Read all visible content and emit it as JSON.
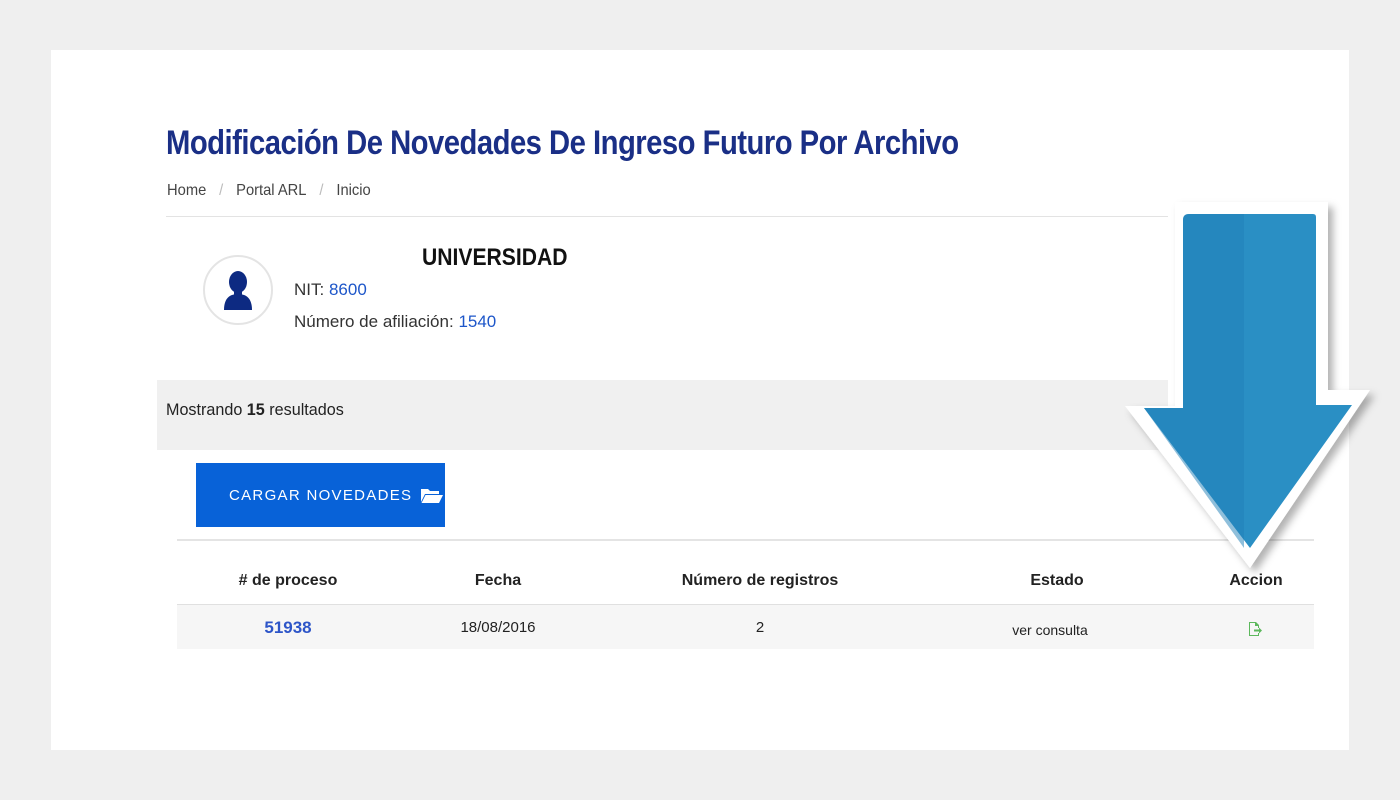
{
  "page": {
    "title": "Modificación De Novedades De Ingreso Futuro Por Archivo",
    "breadcrumb": [
      "Home",
      "Portal ARL",
      "Inicio"
    ]
  },
  "company": {
    "name": "UNIVERSIDAD",
    "nit_label": "NIT:",
    "nit_value": "8600",
    "affiliation_label": "Número de afiliación:",
    "affiliation_value": "1540"
  },
  "results": {
    "prefix": "Mostrando",
    "count": "15",
    "suffix": "resultados"
  },
  "actions": {
    "upload_label": "CARGAR NOVEDADES",
    "upload_icon": "folder-open-icon"
  },
  "table": {
    "headers": [
      "# de proceso",
      "Fecha",
      "Número de registros",
      "Estado",
      "Accion"
    ],
    "rows": [
      {
        "process": "51938",
        "date": "18/08/2016",
        "records": "2",
        "status": "ver consulta",
        "action_icon": "export-file-icon"
      }
    ]
  },
  "colors": {
    "title": "#1a2f86",
    "link": "#1d56c9",
    "button": "#0862d8",
    "arrow": "#2a8fc4",
    "action_icon": "#5cb85c"
  },
  "overlay": {
    "arrow_icon": "down-arrow-icon"
  }
}
